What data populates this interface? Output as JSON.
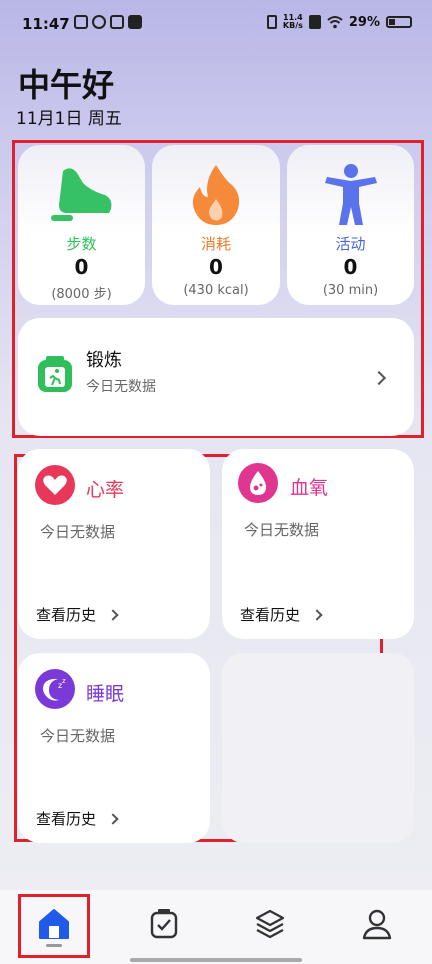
{
  "status": {
    "time": "11:47",
    "net_speed_value": "11.4",
    "net_speed_unit": "KB/s",
    "battery": "29%"
  },
  "header": {
    "greeting": "中午好",
    "date": "11月1日 周五"
  },
  "metrics": [
    {
      "label": "步数",
      "value": "0",
      "target": "(8000 步)",
      "color": "#2fbf5a"
    },
    {
      "label": "消耗",
      "value": "0",
      "target": "(430 kcal)",
      "color": "#f07a2a"
    },
    {
      "label": "活动",
      "value": "0",
      "target": "(30 min)",
      "color": "#4a63e0"
    }
  ],
  "exercise": {
    "title": "锻炼",
    "subtitle": "今日无数据"
  },
  "heart_rate": {
    "title": "心率",
    "subtitle": "今日无数据",
    "history": "查看历史",
    "color": "#e8385a"
  },
  "blood_oxygen": {
    "title": "血氧",
    "subtitle": "今日无数据",
    "history": "查看历史",
    "color": "#e0368f"
  },
  "sleep": {
    "title": "睡眠",
    "subtitle": "今日无数据",
    "history": "查看历史",
    "color": "#7b3ad8"
  },
  "nav": {
    "active_color": "#1f5be8"
  }
}
